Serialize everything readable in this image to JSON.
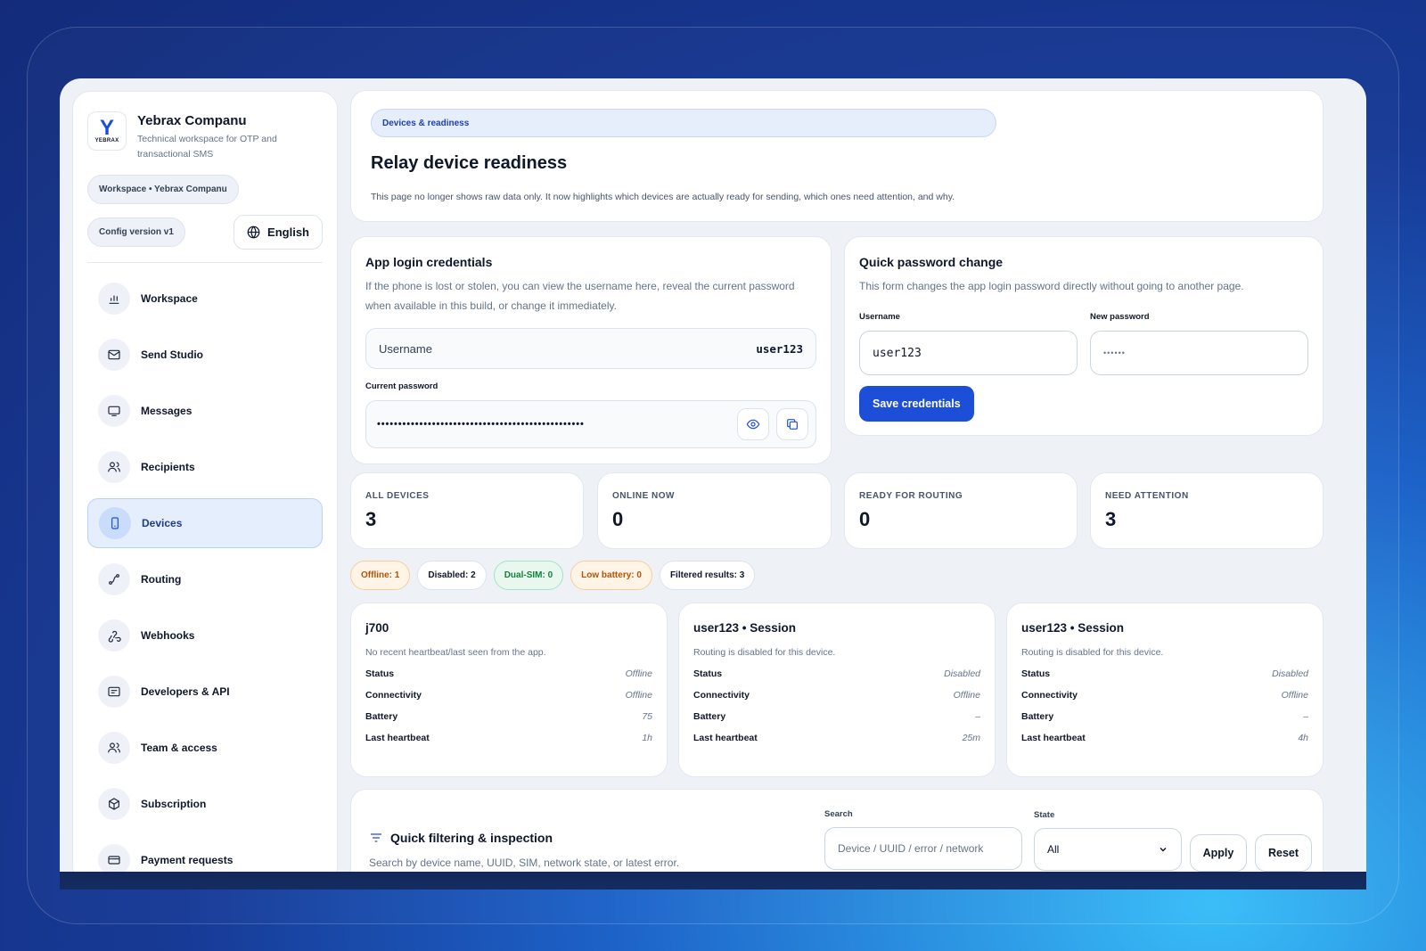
{
  "brand": {
    "name": "Yebrax Companu",
    "subtitle": "Technical workspace for OTP and transactional SMS",
    "logo_letter": "Y",
    "logo_text": "YEBRAX"
  },
  "sidebar": {
    "workspace_chip": "Workspace • Yebrax Companu",
    "config_chip": "Config version v1",
    "language_button": "English",
    "items": [
      {
        "label": "Workspace",
        "icon": "bar-chart-icon"
      },
      {
        "label": "Send Studio",
        "icon": "mail-icon"
      },
      {
        "label": "Messages",
        "icon": "inbox-icon"
      },
      {
        "label": "Recipients",
        "icon": "users-icon"
      },
      {
        "label": "Devices",
        "icon": "phone-icon",
        "active": true
      },
      {
        "label": "Routing",
        "icon": "route-icon"
      },
      {
        "label": "Webhooks",
        "icon": "webhook-icon"
      },
      {
        "label": "Developers & API",
        "icon": "code-icon"
      },
      {
        "label": "Team & access",
        "icon": "team-icon"
      },
      {
        "label": "Subscription",
        "icon": "box-icon"
      },
      {
        "label": "Payment requests",
        "icon": "card-icon"
      }
    ]
  },
  "header": {
    "tag": "Devices & readiness",
    "title": "Relay device readiness",
    "description": "This page no longer shows raw data only. It now highlights which devices are actually ready for sending, which ones need attention, and why."
  },
  "credentials": {
    "title": "App login credentials",
    "text": "If the phone is lost or stolen, you can view the username here, reveal the current password when available in this build, or change it immediately.",
    "username_label": "Username",
    "username_value": "user123",
    "password_label": "Current password",
    "password_mask": "•••••••••••••••••••••••••••••••••••••••••••••••••"
  },
  "password_change": {
    "title": "Quick password change",
    "text": "This form changes the app login password directly without going to another page.",
    "username_label": "Username",
    "username_value": "user123",
    "new_password_label": "New password",
    "new_password_placeholder": "••••••",
    "save_button": "Save credentials"
  },
  "stats": [
    {
      "label": "ALL DEVICES",
      "value": "3"
    },
    {
      "label": "ONLINE NOW",
      "value": "0"
    },
    {
      "label": "READY FOR ROUTING",
      "value": "0"
    },
    {
      "label": "NEED ATTENTION",
      "value": "3"
    }
  ],
  "badges": [
    {
      "text": "Offline: 1",
      "style": "orange"
    },
    {
      "text": "Disabled: 2",
      "style": "plain"
    },
    {
      "text": "Dual-SIM: 0",
      "style": "green"
    },
    {
      "text": "Low battery: 0",
      "style": "orange"
    },
    {
      "text": "Filtered results: 3",
      "style": "plain"
    }
  ],
  "devices": [
    {
      "name": "j700",
      "note": "No recent heartbeat/last seen from the app.",
      "rows": [
        {
          "k": "Status",
          "v": "Offline"
        },
        {
          "k": "Connectivity",
          "v": "Offline"
        },
        {
          "k": "Battery",
          "v": "75"
        },
        {
          "k": "Last heartbeat",
          "v": "1h"
        }
      ]
    },
    {
      "name": "user123 • Session",
      "note": "Routing is disabled for this device.",
      "rows": [
        {
          "k": "Status",
          "v": "Disabled"
        },
        {
          "k": "Connectivity",
          "v": "Offline"
        },
        {
          "k": "Battery",
          "v": "–"
        },
        {
          "k": "Last heartbeat",
          "v": "25m"
        }
      ]
    },
    {
      "name": "user123 • Session",
      "note": "Routing is disabled for this device.",
      "rows": [
        {
          "k": "Status",
          "v": "Disabled"
        },
        {
          "k": "Connectivity",
          "v": "Offline"
        },
        {
          "k": "Battery",
          "v": "–"
        },
        {
          "k": "Last heartbeat",
          "v": "4h"
        }
      ]
    }
  ],
  "filter": {
    "title": "Quick filtering & inspection",
    "subtitle": "Search by device name, UUID, SIM, network state, or latest error.",
    "search_label": "Search",
    "search_placeholder": "Device / UUID / error / network",
    "state_label": "State",
    "state_value": "All",
    "apply_button": "Apply",
    "reset_button": "Reset"
  },
  "colors": {
    "accent": "#1d4ed8",
    "active_nav_bg": "#e4eefd",
    "offline_badge": "#b45309",
    "dual_sim_badge": "#15803d"
  }
}
